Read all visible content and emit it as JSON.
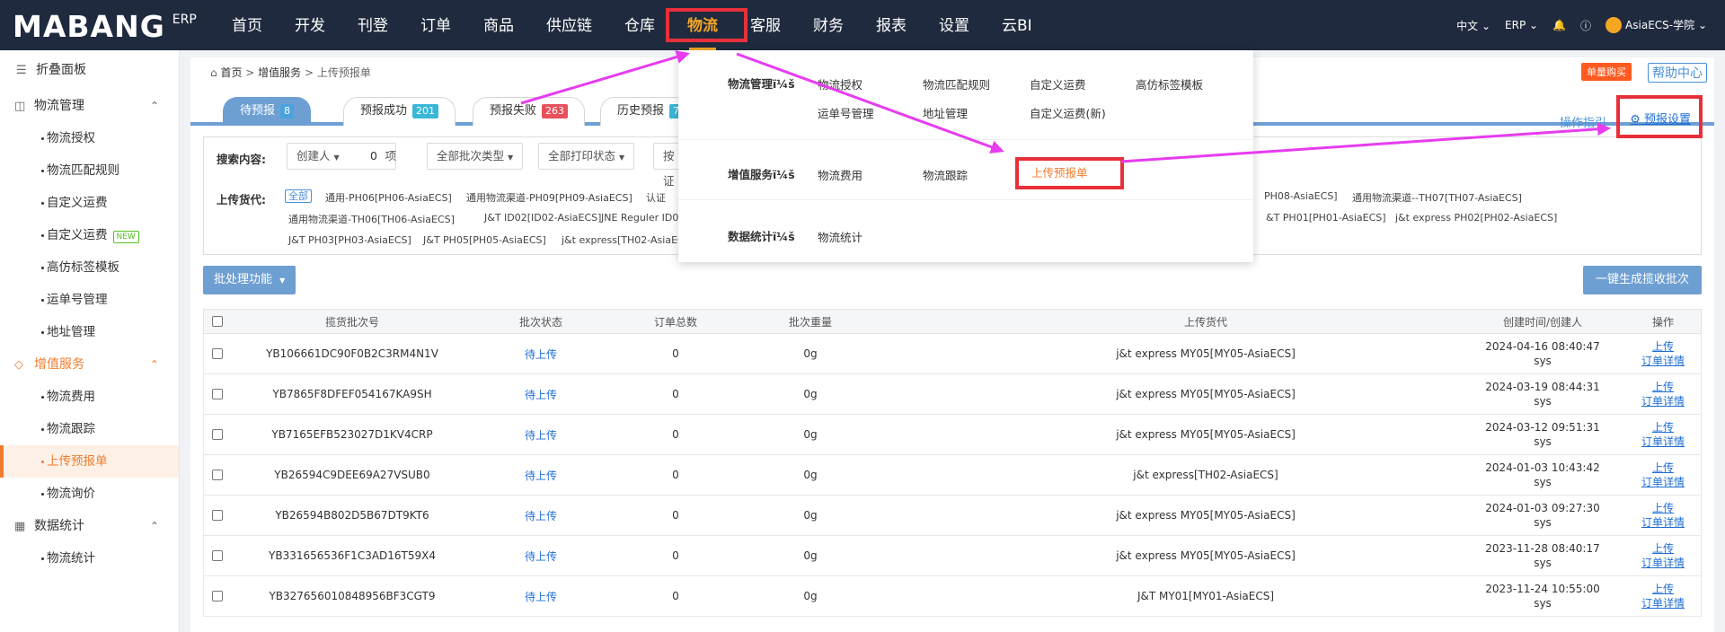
{
  "topnav": {
    "logo": "MABANG",
    "logo_erp": "ERP",
    "menu": [
      "首页",
      "开发",
      "刊登",
      "订单",
      "商品",
      "供应链",
      "仓库",
      "物流",
      "客服",
      "财务",
      "报表",
      "设置",
      "云BI"
    ],
    "active_menu": "物流",
    "lang": "中文",
    "erp": "ERP",
    "user": "AsiaECS-学院"
  },
  "sidebar": {
    "fold": "折叠面板",
    "groups": [
      {
        "label": "物流管理",
        "items": [
          "物流授权",
          "物流匹配规则",
          "自定义运费",
          "自定义运费",
          "高仿标签模板",
          "运单号管理",
          "地址管理"
        ]
      },
      {
        "label": "增值服务",
        "items": [
          "物流费用",
          "物流跟踪",
          "上传预报单",
          "物流询价"
        ]
      },
      {
        "label": "数据统计",
        "items": [
          "物流统计"
        ]
      }
    ],
    "new_badge": "NEW",
    "active_item": "上传预报单"
  },
  "breadcrumb": [
    "首页",
    "增值服务",
    "上传预报单"
  ],
  "hot_button": "单量购买",
  "help": "帮助中心",
  "tabs": [
    {
      "label": "待预报",
      "count": "8",
      "color": "#4aa3df"
    },
    {
      "label": "预报成功",
      "count": "201",
      "color": "#3ab7d8"
    },
    {
      "label": "预报失败",
      "count": "263",
      "color": "#e8505b"
    },
    {
      "label": "历史预报",
      "count": "7",
      "color": "#3ab7d8"
    }
  ],
  "tab_guide": "操作指引",
  "settings_link": "预报设置",
  "search": {
    "label": "搜索内容:",
    "creator": "创建人",
    "count_value": "0",
    "count_unit": "项",
    "batch_type": "全部批次类型",
    "print_status": "全部打印状态",
    "more": "按证"
  },
  "forwarders": {
    "label": "上传货代:",
    "all": "全部",
    "row1": [
      "通用-PH06[PH06-AsiaECS]",
      "通用物流渠道-PH09[PH09-AsiaECS]",
      "认证"
    ],
    "row1_right": [
      "PH08-AsiaECS]",
      "通用物流渠道--TH07[TH07-AsiaECS]"
    ],
    "row2": [
      "通用物流渠道-TH06[TH06-AsiaECS]",
      "J&T ID02[ID02-AsiaECS]",
      "JNE Reguler ID0"
    ],
    "row2_right": [
      "&T PH01[PH01-AsiaECS]",
      "j&t express PH02[PH02-AsiaECS]"
    ],
    "row3": [
      "J&T PH03[PH03-AsiaECS]",
      "J&T PH05[PH05-AsiaECS]",
      "j&t express[TH02-AsiaEC"
    ]
  },
  "batch_button": "批处理功能",
  "generate_button": "一键生成揽收批次",
  "table": {
    "headers": [
      "揽货批次号",
      "批次状态",
      "订单总数",
      "批次重量",
      "上传货代",
      "创建时间/创建人",
      "操作"
    ],
    "rows": [
      {
        "id": "YB106661DC90F0B2C3RM4N1V",
        "status": "待上传",
        "total": "0",
        "weight": "0g",
        "forwarder": "j&t express MY05[MY05-AsiaECS]",
        "time": "2024-04-16 08:40:47",
        "user": "sys"
      },
      {
        "id": "YB7865F8DFEF054167KA9SH",
        "status": "待上传",
        "total": "0",
        "weight": "0g",
        "forwarder": "j&t express MY05[MY05-AsiaECS]",
        "time": "2024-03-19 08:44:31",
        "user": "sys"
      },
      {
        "id": "YB7165EFB523027D1KV4CRP",
        "status": "待上传",
        "total": "0",
        "weight": "0g",
        "forwarder": "j&t express MY05[MY05-AsiaECS]",
        "time": "2024-03-12 09:51:31",
        "user": "sys"
      },
      {
        "id": "YB26594C9DEE69A27VSUB0",
        "status": "待上传",
        "total": "0",
        "weight": "0g",
        "forwarder": "j&t express[TH02-AsiaECS]",
        "time": "2024-01-03 10:43:42",
        "user": "sys"
      },
      {
        "id": "YB26594B802D5B67DT9KT6",
        "status": "待上传",
        "total": "0",
        "weight": "0g",
        "forwarder": "j&t express MY05[MY05-AsiaECS]",
        "time": "2024-01-03 09:27:30",
        "user": "sys"
      },
      {
        "id": "YB331656536F1C3AD16T59X4",
        "status": "待上传",
        "total": "0",
        "weight": "0g",
        "forwarder": "j&t express MY05[MY05-AsiaECS]",
        "time": "2023-11-28 08:40:17",
        "user": "sys"
      },
      {
        "id": "YB327656010848956BF3CGT9",
        "status": "待上传",
        "total": "0",
        "weight": "0g",
        "forwarder": "J&T MY01[MY01-AsiaECS]",
        "time": "2023-11-24 10:55:00",
        "user": "sys"
      }
    ],
    "op_upload": "上传",
    "op_detail": "订单详情"
  },
  "dropdown": {
    "sections": [
      {
        "head": "物流管理ï¼š",
        "items": [
          "物流授权",
          "物流匹配规则",
          "自定义运费",
          "高仿标签模板",
          "运单号管理",
          "地址管理",
          "自定义运费(新)"
        ]
      },
      {
        "head": "增值服务ï¼š",
        "items": [
          "物流费用",
          "物流跟踪",
          "上传预报单"
        ]
      },
      {
        "head": "数据统计ï¼š",
        "items": [
          "物流统计"
        ]
      }
    ]
  },
  "colors": {
    "annotation": "#e8303a",
    "arrow": "#e73cf0",
    "accent": "#f07d2f",
    "nav": "#1f2a3e"
  }
}
